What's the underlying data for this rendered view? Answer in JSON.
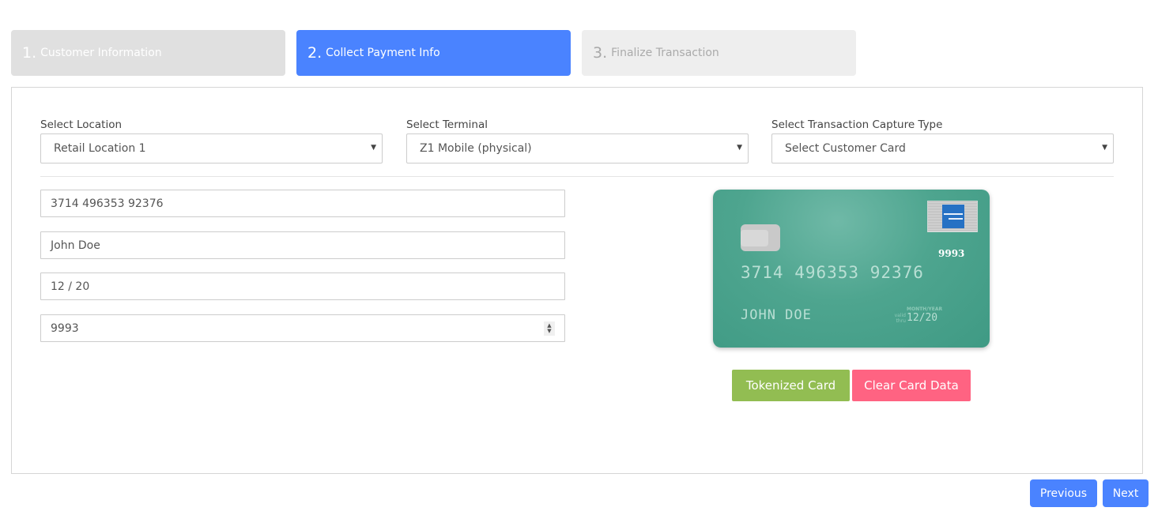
{
  "wizard": {
    "steps": [
      {
        "number": "1.",
        "label": "Customer Information",
        "state": "completed"
      },
      {
        "number": "2.",
        "label": "Collect Payment Info",
        "state": "active"
      },
      {
        "number": "3.",
        "label": "Finalize Transaction",
        "state": "pending"
      }
    ]
  },
  "selectors": {
    "location": {
      "label": "Select Location",
      "value": "Retail Location 1"
    },
    "terminal": {
      "label": "Select Terminal",
      "value": "Z1 Mobile (physical)"
    },
    "capture_type": {
      "label": "Select Transaction Capture Type",
      "value": "Select Customer Card"
    }
  },
  "form": {
    "card_number": "3714 496353 92376",
    "cardholder_name": "John Doe",
    "expiry": "12 / 20",
    "cvv": "9993"
  },
  "card_preview": {
    "brand": "American Express",
    "brand_icon": "amex-logo-icon",
    "cvv": "9993",
    "number": "3714 496353 92376",
    "name": "JOHN DOE",
    "valid_thru_label": "valid thru",
    "month_year_label": "MONTH/YEAR",
    "expiry": "12/20",
    "color": "#4ea58f"
  },
  "actions": {
    "tokenized_card": "Tokenized Card",
    "clear_card_data": "Clear Card Data",
    "previous": "Previous",
    "next": "Next"
  },
  "colors": {
    "primary": "#4a83ff",
    "success": "#92bd52",
    "danger": "#ff6382",
    "step_completed": "#e0e0e0",
    "step_pending": "#eeeeee"
  }
}
